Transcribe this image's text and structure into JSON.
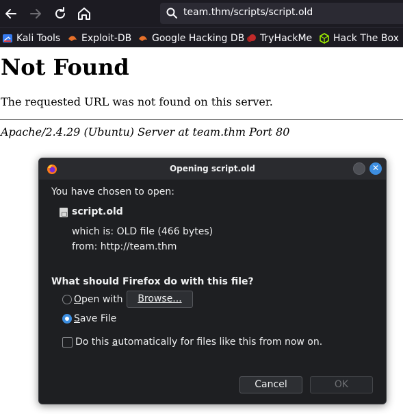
{
  "browser": {
    "url": "team.thm/scripts/script.old",
    "nav": {
      "back_icon": "back-arrow-icon",
      "forward_icon": "forward-arrow-icon",
      "reload_icon": "reload-icon",
      "home_icon": "home-icon"
    },
    "bookmarks": [
      {
        "label": "Kali Tools",
        "icon": "kali-icon"
      },
      {
        "label": "Exploit-DB",
        "icon": "exploit-db-icon"
      },
      {
        "label": "Google Hacking DB",
        "icon": "ghdb-icon"
      },
      {
        "label": "TryHackMe",
        "icon": "tryhackme-icon"
      },
      {
        "label": "Hack The Box",
        "icon": "hackthebox-icon"
      }
    ]
  },
  "page": {
    "heading": "Not Found",
    "message": "The requested URL was not found on this server.",
    "address": "Apache/2.4.29 (Ubuntu) Server at team.thm Port 80"
  },
  "dialog": {
    "title": "Opening script.old",
    "intro": "You have chosen to open:",
    "filename": "script.old",
    "which_is_label": "which is:",
    "which_is_value": "OLD file (466 bytes)",
    "from_label": "from:",
    "from_value": "http://team.thm",
    "question": "What should Firefox do with this file?",
    "open_with_prefix": "O",
    "open_with_rest": "pen with",
    "browse_label": "Browse...",
    "save_file_prefix": "S",
    "save_file_rest": "ave File",
    "auto_text_a": "Do this ",
    "auto_text_u": "a",
    "auto_text_b": "utomatically for files like this from now on.",
    "cancel_label": "Cancel",
    "ok_label": "OK",
    "selected_option": "save_file",
    "auto_checked": false
  }
}
